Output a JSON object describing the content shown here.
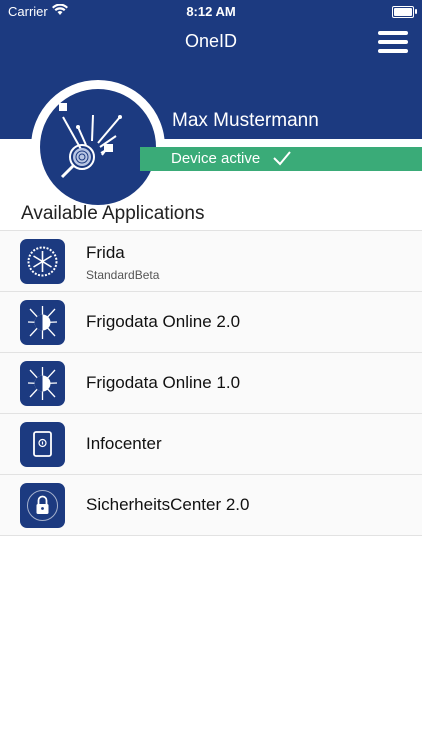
{
  "status_bar": {
    "carrier": "Carrier",
    "time": "8:12 AM"
  },
  "header": {
    "title": "OneID"
  },
  "profile": {
    "name": "Max Mustermann",
    "device_status": "Device active"
  },
  "applications": {
    "heading": "Available Applications",
    "items": [
      {
        "name": "Frida",
        "subtitle": "StandardBeta",
        "icon": "snowflake-gear-icon"
      },
      {
        "name": "Frigodata Online 2.0",
        "icon": "frigodata-network-icon"
      },
      {
        "name": "Frigodata Online 1.0",
        "icon": "frigodata-network-icon"
      },
      {
        "name": "Infocenter",
        "icon": "tablet-info-icon"
      },
      {
        "name": "SicherheitsCenter 2.0",
        "icon": "padlock-icon"
      }
    ]
  },
  "colors": {
    "header_bg": "#1c3a80",
    "status_green": "#3aab78"
  }
}
